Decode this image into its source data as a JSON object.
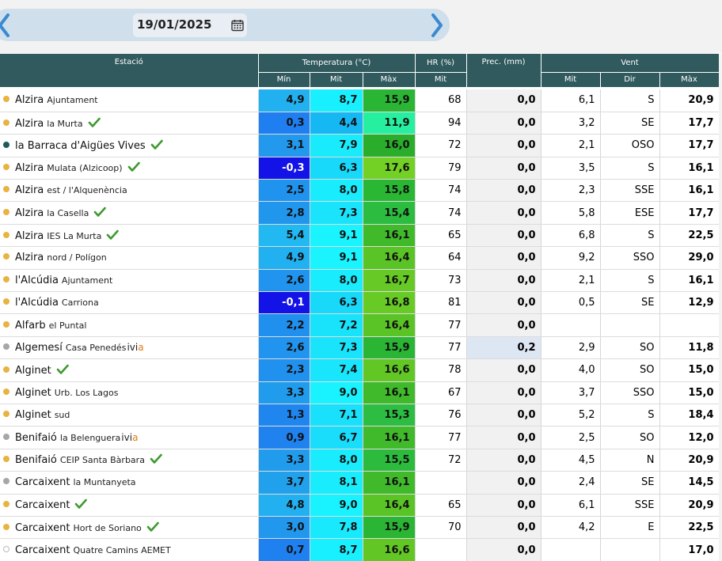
{
  "date": "19/01/2025",
  "headers": {
    "station": "Estació",
    "temperature": "Temperatura (°C)",
    "humidity": "HR (%)",
    "precipitation": "Prec. (mm)",
    "wind": "Vent",
    "t_min": "Mín",
    "t_mit": "Mit",
    "t_max": "Màx",
    "hr_mit": "Mit",
    "w_mit": "Mit",
    "w_dir": "Dir",
    "w_max": "Màx"
  },
  "colors": {
    "header_bg": "#305a5e",
    "dot_yellow": "#e8b341",
    "dot_teal": "#1f5a5a",
    "dot_grey": "#a7a7a7",
    "check": "#3e9a2f",
    "rain_bg": "#dde6f3"
  },
  "rows": [
    {
      "town": "Alzira",
      "site": "Ajuntament",
      "dot": "yellow",
      "check": false,
      "ivia": false,
      "tmin": "4,9",
      "tmin_c": "#22b1f0",
      "tmit": "8,7",
      "tmit_c": "#19f0ff",
      "tmax": "15,9",
      "tmax_c": "#2ab534",
      "hr": "68",
      "prec": "0,0",
      "rain": false,
      "wmit": "6,1",
      "wdir": "S",
      "wmax": "20,9"
    },
    {
      "town": "Alzira",
      "site": "la Murta",
      "dot": "yellow",
      "check": true,
      "ivia": false,
      "tmin": "0,3",
      "tmin_c": "#1f7ef0",
      "tmit": "4,4",
      "tmit_c": "#16b8f4",
      "tmax": "11,9",
      "tmax_c": "#26f0a0",
      "hr": "94",
      "prec": "0,0",
      "rain": false,
      "wmit": "3,2",
      "wdir": "SE",
      "wmax": "17,7"
    },
    {
      "town": "la Barraca d'Aigües Vives",
      "site": "",
      "dot": "teal",
      "check": true,
      "ivia": false,
      "tmin": "3,1",
      "tmin_c": "#2299ec",
      "tmit": "7,9",
      "tmit_c": "#19eafc",
      "tmax": "16,0",
      "tmax_c": "#29ad2a",
      "hr": "72",
      "prec": "0,0",
      "rain": false,
      "wmit": "2,1",
      "wdir": "OSO",
      "wmax": "17,7"
    },
    {
      "town": "Alzira",
      "site": "Mulata (Alzicoop)",
      "dot": "yellow",
      "check": true,
      "ivia": false,
      "tmin": "-0,3",
      "tmin_c": "#1313e8",
      "tmit": "6,3",
      "tmit_c": "#18d9fa",
      "tmax": "17,6",
      "tmax_c": "#73d024",
      "hr": "79",
      "prec": "0,0",
      "rain": false,
      "wmit": "3,5",
      "wdir": "S",
      "wmax": "16,1"
    },
    {
      "town": "Alzira",
      "site": "est / l'Alquenència",
      "dot": "yellow",
      "check": false,
      "ivia": false,
      "tmin": "2,5",
      "tmin_c": "#2093ee",
      "tmit": "8,0",
      "tmit_c": "#19ecfd",
      "tmax": "15,8",
      "tmax_c": "#2ab834",
      "hr": "74",
      "prec": "0,0",
      "rain": false,
      "wmit": "2,3",
      "wdir": "SSE",
      "wmax": "16,1"
    },
    {
      "town": "Alzira",
      "site": "la Casella",
      "dot": "yellow",
      "check": true,
      "ivia": false,
      "tmin": "2,8",
      "tmin_c": "#2196ed",
      "tmit": "7,3",
      "tmit_c": "#19e4fc",
      "tmax": "15,4",
      "tmax_c": "#2cbc3f",
      "hr": "74",
      "prec": "0,0",
      "rain": false,
      "wmit": "5,8",
      "wdir": "ESE",
      "wmax": "17,7"
    },
    {
      "town": "Alzira",
      "site": "IES La Murta",
      "dot": "yellow",
      "check": true,
      "ivia": false,
      "tmin": "5,4",
      "tmin_c": "#22b8f1",
      "tmit": "9,1",
      "tmit_c": "#19f4ff",
      "tmax": "16,1",
      "tmax_c": "#40b92a",
      "hr": "65",
      "prec": "0,0",
      "rain": false,
      "wmit": "6,8",
      "wdir": "S",
      "wmax": "22,5"
    },
    {
      "town": "Alzira",
      "site": "nord / Polígon",
      "dot": "yellow",
      "check": false,
      "ivia": false,
      "tmin": "4,9",
      "tmin_c": "#22b1f0",
      "tmit": "9,1",
      "tmit_c": "#19f4ff",
      "tmax": "16,4",
      "tmax_c": "#5ac426",
      "hr": "64",
      "prec": "0,0",
      "rain": false,
      "wmit": "9,2",
      "wdir": "SSO",
      "wmax": "29,0"
    },
    {
      "town": "l'Alcúdia",
      "site": "Ajuntament",
      "dot": "yellow",
      "check": false,
      "ivia": false,
      "tmin": "2,6",
      "tmin_c": "#2094ee",
      "tmit": "8,0",
      "tmit_c": "#19ecfd",
      "tmax": "16,7",
      "tmax_c": "#66c925",
      "hr": "73",
      "prec": "0,0",
      "rain": false,
      "wmit": "2,1",
      "wdir": "S",
      "wmax": "16,1"
    },
    {
      "town": "l'Alcúdia",
      "site": "Carriona",
      "dot": "yellow",
      "check": false,
      "ivia": false,
      "tmin": "-0,1",
      "tmin_c": "#1313e8",
      "tmit": "6,3",
      "tmit_c": "#18d9fa",
      "tmax": "16,8",
      "tmax_c": "#68ca25",
      "hr": "81",
      "prec": "0,0",
      "rain": false,
      "wmit": "0,5",
      "wdir": "SE",
      "wmax": "12,9"
    },
    {
      "town": "Alfarb",
      "site": "el Puntal",
      "dot": "yellow",
      "check": false,
      "ivia": false,
      "tmin": "2,2",
      "tmin_c": "#2090ee",
      "tmit": "7,2",
      "tmit_c": "#19e2fb",
      "tmax": "16,4",
      "tmax_c": "#5ac426",
      "hr": "77",
      "prec": "0,0",
      "rain": false,
      "wmit": "",
      "wdir": "",
      "wmax": ""
    },
    {
      "town": "Algemesí",
      "site": "Casa Penedés",
      "dot": "grey",
      "check": false,
      "ivia": true,
      "tmin": "2,6",
      "tmin_c": "#2094ee",
      "tmit": "7,3",
      "tmit_c": "#19e4fc",
      "tmax": "15,9",
      "tmax_c": "#2ab534",
      "hr": "77",
      "prec": "0,2",
      "rain": true,
      "wmit": "2,9",
      "wdir": "SO",
      "wmax": "11,8"
    },
    {
      "town": "Alginet",
      "site": "",
      "dot": "yellow",
      "check": true,
      "ivia": false,
      "tmin": "2,3",
      "tmin_c": "#2091ee",
      "tmit": "7,4",
      "tmit_c": "#19e5fc",
      "tmax": "16,6",
      "tmax_c": "#62c725",
      "hr": "78",
      "prec": "0,0",
      "rain": false,
      "wmit": "4,0",
      "wdir": "SO",
      "wmax": "15,0"
    },
    {
      "town": "Alginet",
      "site": "Urb. Los Lagos",
      "dot": "yellow",
      "check": false,
      "ivia": false,
      "tmin": "3,3",
      "tmin_c": "#219bec",
      "tmit": "9,0",
      "tmit_c": "#19f3ff",
      "tmax": "16,1",
      "tmax_c": "#40b92a",
      "hr": "67",
      "prec": "0,0",
      "rain": false,
      "wmit": "3,7",
      "wdir": "SSO",
      "wmax": "15,0"
    },
    {
      "town": "Alginet",
      "site": "sud",
      "dot": "yellow",
      "check": false,
      "ivia": false,
      "tmin": "1,3",
      "tmin_c": "#1f86ef",
      "tmit": "7,1",
      "tmit_c": "#19e1fb",
      "tmax": "15,3",
      "tmax_c": "#2dbd42",
      "hr": "76",
      "prec": "0,0",
      "rain": false,
      "wmit": "5,2",
      "wdir": "S",
      "wmax": "18,4"
    },
    {
      "town": "Benifaió",
      "site": "la Belenguera",
      "dot": "grey",
      "check": false,
      "ivia": true,
      "tmin": "0,9",
      "tmin_c": "#1f82ef",
      "tmit": "6,7",
      "tmit_c": "#19ddfb",
      "tmax": "16,1",
      "tmax_c": "#40b92a",
      "hr": "77",
      "prec": "0,0",
      "rain": false,
      "wmit": "2,5",
      "wdir": "SO",
      "wmax": "12,0"
    },
    {
      "town": "Benifaió",
      "site": "CEIP Santa Bàrbara",
      "dot": "yellow",
      "check": true,
      "ivia": false,
      "tmin": "3,3",
      "tmin_c": "#219bec",
      "tmit": "8,0",
      "tmit_c": "#19ecfd",
      "tmax": "15,5",
      "tmax_c": "#2cbb3c",
      "hr": "72",
      "prec": "0,0",
      "rain": false,
      "wmit": "4,5",
      "wdir": "N",
      "wmax": "20,9"
    },
    {
      "town": "Carcaixent",
      "site": "la Muntanyeta",
      "dot": "grey",
      "check": false,
      "ivia": false,
      "tmin": "3,7",
      "tmin_c": "#21a1ec",
      "tmit": "8,1",
      "tmit_c": "#19edfd",
      "tmax": "16,1",
      "tmax_c": "#40b92a",
      "hr": "",
      "prec": "0,0",
      "rain": false,
      "wmit": "2,4",
      "wdir": "SE",
      "wmax": "14,5"
    },
    {
      "town": "Carcaixent",
      "site": "",
      "dot": "yellow",
      "check": true,
      "ivia": false,
      "tmin": "4,8",
      "tmin_c": "#22b0f0",
      "tmit": "9,0",
      "tmit_c": "#19f3ff",
      "tmax": "16,4",
      "tmax_c": "#5ac426",
      "hr": "65",
      "prec": "0,0",
      "rain": false,
      "wmit": "6,1",
      "wdir": "SSE",
      "wmax": "20,9"
    },
    {
      "town": "Carcaixent",
      "site": "Hort de Soriano",
      "dot": "yellow",
      "check": true,
      "ivia": false,
      "tmin": "3,0",
      "tmin_c": "#2198ed",
      "tmit": "7,8",
      "tmit_c": "#19e9fc",
      "tmax": "15,9",
      "tmax_c": "#2ab534",
      "hr": "70",
      "prec": "0,0",
      "rain": false,
      "wmit": "4,2",
      "wdir": "E",
      "wmax": "22,5"
    },
    {
      "town": "Carcaixent",
      "site": "Quatre Camins AEMET",
      "dot": "outline",
      "check": false,
      "ivia": false,
      "tmin": "0,7",
      "tmin_c": "#1f80ef",
      "tmit": "8,7",
      "tmit_c": "#19f0ff",
      "tmax": "16,6",
      "tmax_c": "#62c725",
      "hr": "",
      "prec": "0,0",
      "rain": false,
      "wmit": "",
      "wdir": "",
      "wmax": "17,0"
    }
  ]
}
